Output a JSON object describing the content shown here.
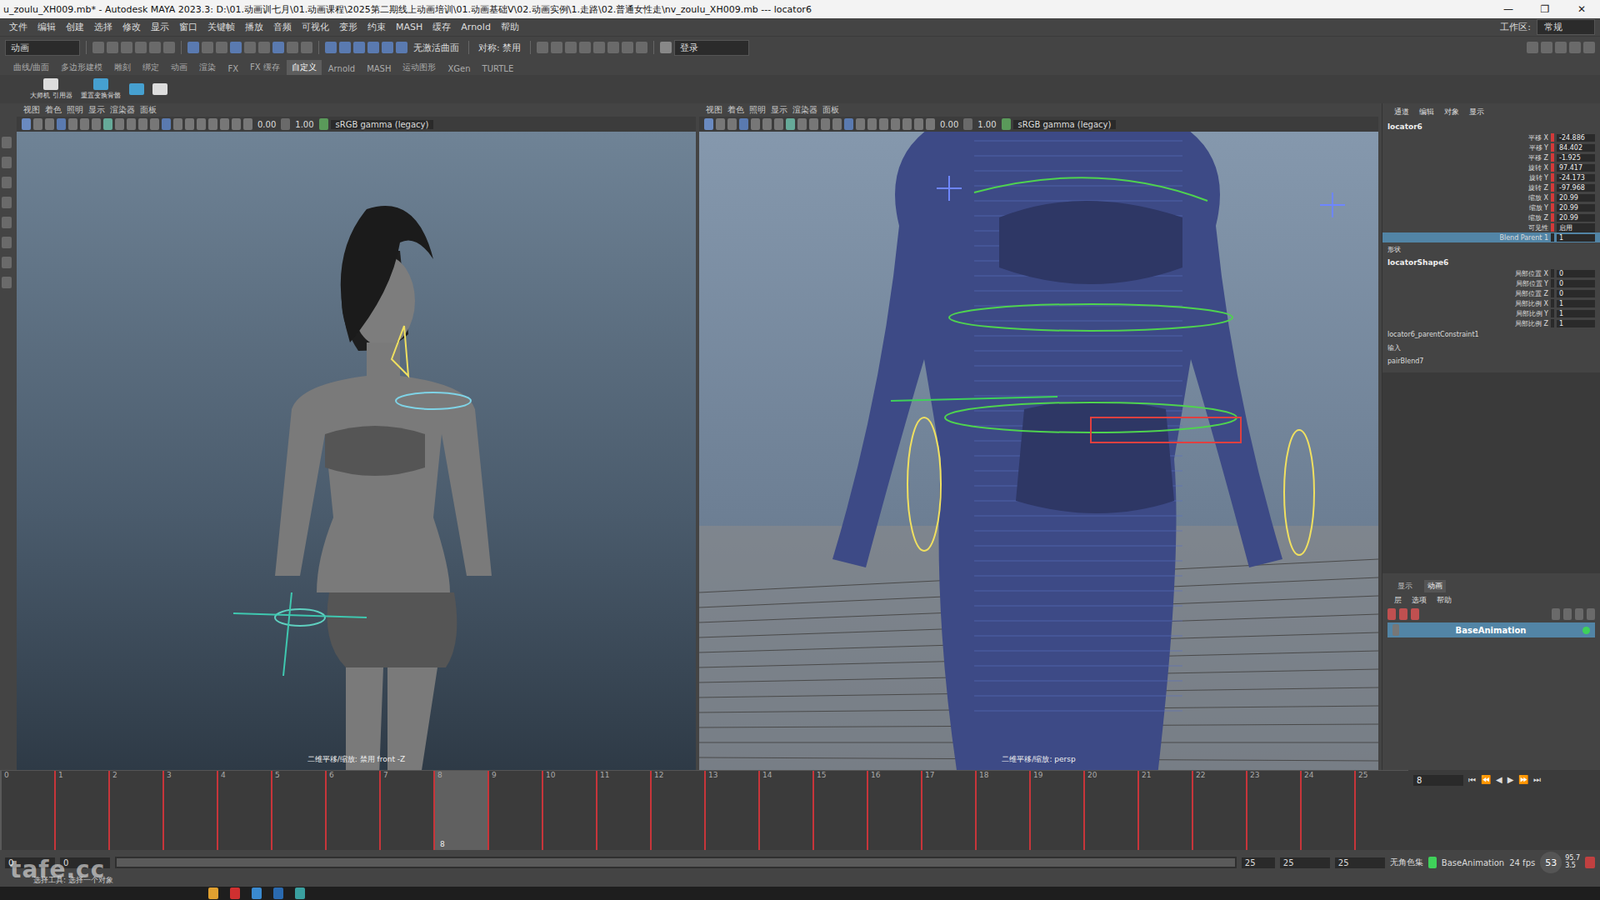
{
  "window": {
    "title": "u_zoulu_XH009.mb* - Autodesk MAYA 2023.3: D:\\01.动画训七月\\01.动画课程\\2025第二期线上动画培训\\01.动画基础V\\02.动画实例\\1.走路\\02.普通女性走\\nv_zoulu_XH009.mb  ---  locator6",
    "buttons": [
      "—",
      "❐",
      "✕"
    ]
  },
  "menu": [
    "文件",
    "编辑",
    "创建",
    "选择",
    "修改",
    "显示",
    "窗口",
    "关键帧",
    "播放",
    "音频",
    "可视化",
    "变形",
    "约束",
    "MASH",
    "缓存",
    "Arnold",
    "帮助"
  ],
  "workspace": {
    "label": "工作区:",
    "value": "常规"
  },
  "status_line": {
    "mode": "动画",
    "live": "无激活曲面",
    "symmetry": "对称: 禁用",
    "login": "登录"
  },
  "shelf": {
    "tabs": [
      {
        "label": "曲线/曲面",
        "selected": false
      },
      {
        "label": "多边形建模",
        "selected": false
      },
      {
        "label": "雕刻",
        "selected": false
      },
      {
        "label": "绑定",
        "selected": false
      },
      {
        "label": "动画",
        "selected": false
      },
      {
        "label": "渲染",
        "selected": false
      },
      {
        "label": "FX",
        "selected": false
      },
      {
        "label": "FX 缓存",
        "selected": false
      },
      {
        "label": "自定义",
        "selected": true
      },
      {
        "label": "Arnold",
        "selected": false
      },
      {
        "label": "MASH",
        "selected": false
      },
      {
        "label": "运动图形",
        "selected": false
      },
      {
        "label": "XGen",
        "selected": false
      },
      {
        "label": "TURTLE",
        "selected": false
      }
    ],
    "buttons": [
      "大师机 引用器",
      "重置变换骨骼"
    ]
  },
  "viewports": [
    {
      "menu": [
        "视图",
        "着色",
        "照明",
        "显示",
        "渲染器",
        "面板"
      ],
      "exposure": "0.00",
      "gamma": "1.00",
      "color_space": "sRGB gamma (legacy)",
      "label": "二维平移/缩放: 禁用 front -Z",
      "wireframe": false
    },
    {
      "menu": [
        "视图",
        "着色",
        "照明",
        "显示",
        "渲染器",
        "面板"
      ],
      "exposure": "0.00",
      "gamma": "1.00",
      "color_space": "sRGB gamma (legacy)",
      "label": "二维平移/缩放: persp",
      "wireframe": true
    }
  ],
  "channel_box": {
    "tabs": [
      "通道",
      "编辑",
      "对象",
      "显示"
    ],
    "object": "locator6",
    "attributes": [
      {
        "name": "平移 X",
        "value": "-24.886",
        "keyed": true,
        "selected": false
      },
      {
        "name": "平移 Y",
        "value": "84.402",
        "keyed": true,
        "selected": false
      },
      {
        "name": "平移 Z",
        "value": "-1.925",
        "keyed": true,
        "selected": false
      },
      {
        "name": "旋转 X",
        "value": "97.417",
        "keyed": true,
        "selected": false
      },
      {
        "name": "旋转 Y",
        "value": "-24.173",
        "keyed": true,
        "selected": false
      },
      {
        "name": "旋转 Z",
        "value": "-97.968",
        "keyed": true,
        "selected": false
      },
      {
        "name": "缩放 X",
        "value": "20.99",
        "keyed": true,
        "selected": false
      },
      {
        "name": "缩放 Y",
        "value": "20.99",
        "keyed": true,
        "selected": false
      },
      {
        "name": "缩放 Z",
        "value": "20.99",
        "keyed": true,
        "selected": false
      },
      {
        "name": "可见性",
        "value": "启用",
        "keyed": true,
        "selected": false
      },
      {
        "name": "Blend Parent 1",
        "value": "1",
        "keyed": false,
        "selected": true
      }
    ],
    "shape_header": "形状",
    "shape": "locatorShape6",
    "shape_attributes": [
      {
        "name": "局部位置 X",
        "value": "0"
      },
      {
        "name": "局部位置 Y",
        "value": "0"
      },
      {
        "name": "局部位置 Z",
        "value": "0"
      },
      {
        "name": "局部比例 X",
        "value": "1"
      },
      {
        "name": "局部比例 Y",
        "value": "1"
      },
      {
        "name": "局部比例 Z",
        "value": "1"
      }
    ],
    "connections": [
      "locator6_parentConstraint1",
      "输入",
      "pairBlend7"
    ]
  },
  "layers": {
    "tabs": [
      {
        "label": "显示",
        "selected": false
      },
      {
        "label": "动画",
        "selected": true
      }
    ],
    "menu": [
      "层",
      "选项",
      "帮助"
    ],
    "items": [
      {
        "name": "BaseAnimation",
        "selected": true,
        "active": true
      }
    ]
  },
  "timeline": {
    "frames": [
      "0",
      "1",
      "2",
      "3",
      "4",
      "5",
      "6",
      "7",
      "8",
      "9",
      "10",
      "11",
      "12",
      "13",
      "14",
      "15",
      "16",
      "17",
      "18",
      "19",
      "20",
      "21",
      "22",
      "23",
      "24",
      "25"
    ],
    "keys": [
      1,
      2,
      3,
      4,
      5,
      6,
      7,
      8,
      9,
      10,
      11,
      12,
      13,
      14,
      15,
      16,
      17,
      18,
      19,
      20,
      21,
      22,
      23,
      24,
      25
    ],
    "current": "8",
    "controls": [
      "⏮",
      "⏪",
      "◀",
      "▶",
      "⏩",
      "⏭"
    ]
  },
  "range": {
    "start": "0",
    "inner_start": "0",
    "inner_end": "25",
    "end": "25",
    "end2": "25",
    "character_set": "无角色集",
    "layer": "BaseAnimation",
    "fps": "24 fps"
  },
  "perf": {
    "fps": "53",
    "a": "95.7",
    "b": "3.5"
  },
  "help": "选择工具: 选择一个对象",
  "watermark": "tafe.cc"
}
